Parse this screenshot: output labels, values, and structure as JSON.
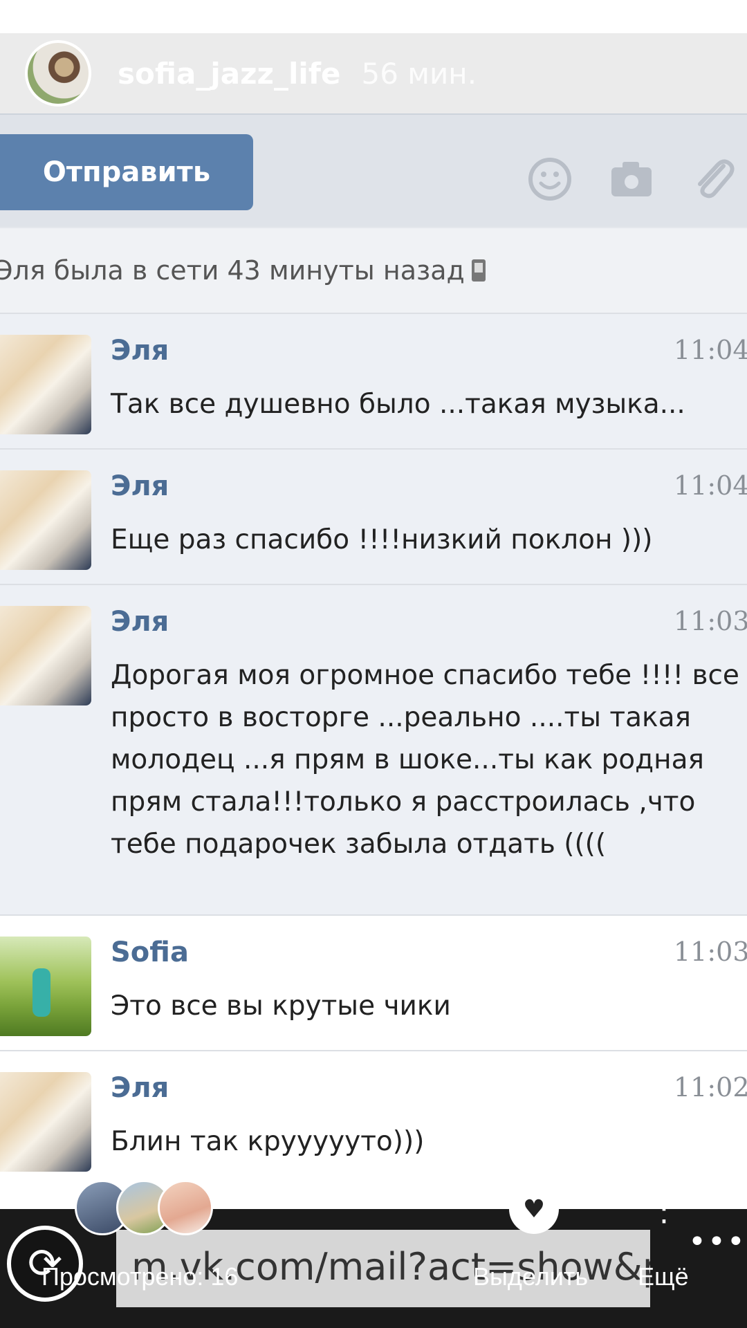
{
  "story": {
    "username": "sofia_jazz_life",
    "time_ago": "56 мин."
  },
  "vk": {
    "send_label": "Отправить",
    "status": "Эля была в сети 43 минуты назад",
    "messages": [
      {
        "name": "Эля",
        "time": "11:04",
        "text": "Так все душевно было ...такая музыка...",
        "avatar": "elya-avatar",
        "state": "unread"
      },
      {
        "name": "Эля",
        "time": "11:04",
        "text": "Еще раз спасибо !!!!низкий поклон )))",
        "avatar": "elya-avatar",
        "state": "unread"
      },
      {
        "name": "Эля",
        "time": "11:03",
        "text": "Дорогая моя огромное спасибо тебе !!!! все просто в восторге ...реально ....ты такая молодец ...я прям в шоке...ты как родная прям стала!!!только я расстроилась ,что тебе подарочек забыла отдать ((((",
        "avatar": "elya-avatar",
        "state": "unread"
      },
      {
        "name": "Sofia",
        "time": "11:03",
        "text": "Это все вы крутые чики",
        "avatar": "sofia-avatar",
        "state": "read"
      },
      {
        "name": "Эля",
        "time": "11:02",
        "text": "Блин так круууууто)))",
        "avatar": "elya-avatar",
        "state": "read"
      }
    ]
  },
  "overlay": {
    "url": "m.vk.com/mail?act=show&p",
    "viewed": "Просмотрено: 16",
    "select": "Выделить",
    "more": "Ещё"
  },
  "icons": {
    "emoji": "smiley-icon",
    "camera": "camera-icon",
    "attach": "paperclip-icon",
    "refresh": "refresh-icon",
    "heart": "heart-icon",
    "more": "more-dots-icon"
  }
}
